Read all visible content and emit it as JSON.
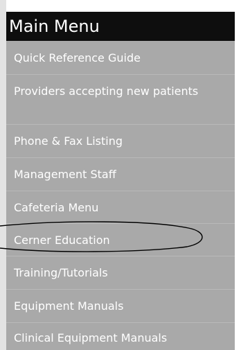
{
  "menu": {
    "title": "Main Menu",
    "items": [
      {
        "label": "Quick Reference Guide"
      },
      {
        "label": "Providers accepting new patients"
      },
      {
        "label": "Phone & Fax Listing"
      },
      {
        "label": "Management Staff"
      },
      {
        "label": "Cafeteria Menu"
      },
      {
        "label": "Cerner Education"
      },
      {
        "label": "Training/Tutorials"
      },
      {
        "label": "Equipment Manuals"
      },
      {
        "label": "Clinical Equipment Manuals"
      }
    ],
    "highlighted_item": "Cerner Education"
  },
  "colors": {
    "header_background": "#0e0e0e",
    "panel_background": "#a9a9a9",
    "text": "#ffffff",
    "annotation": "#000000"
  }
}
